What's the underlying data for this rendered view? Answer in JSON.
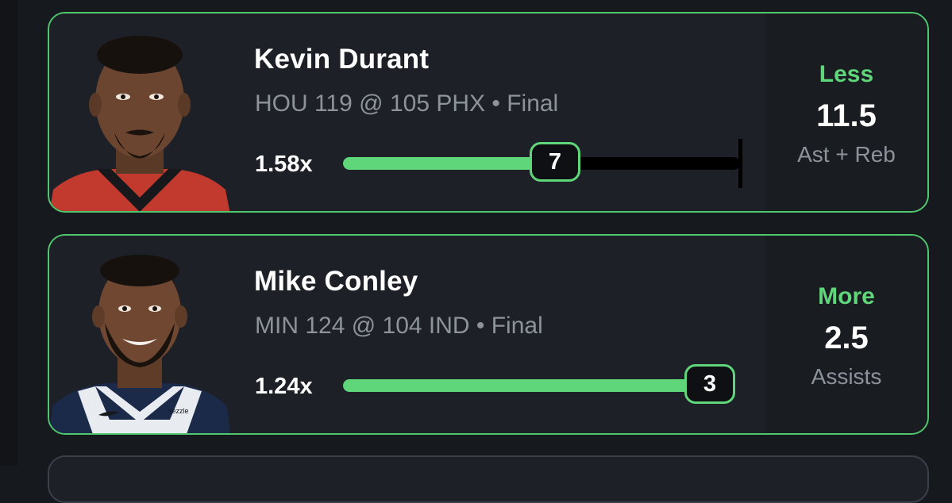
{
  "colors": {
    "accent_green": "#5fd679",
    "card_bg": "#1d2127",
    "page_bg": "#16191e",
    "muted_text": "#8d939b"
  },
  "picks": [
    {
      "player": "Kevin Durant",
      "game": "HOU 119 @ 105 PHX • Final",
      "multiplier": "1.58x",
      "result_value": "7",
      "progress_fraction": 0.53,
      "direction": "Less",
      "line": "11.5",
      "stat": "Ast + Reb",
      "jersey_color": "#c23a2e",
      "avatar_icon": "player-headshot"
    },
    {
      "player": "Mike Conley",
      "game": "MIN 124 @ 104 IND • Final",
      "multiplier": "1.24x",
      "result_value": "3",
      "progress_fraction": 1.0,
      "direction": "More",
      "line": "2.5",
      "stat": "Assists",
      "jersey_color": "#1c2a4a",
      "avatar_icon": "player-headshot"
    }
  ]
}
